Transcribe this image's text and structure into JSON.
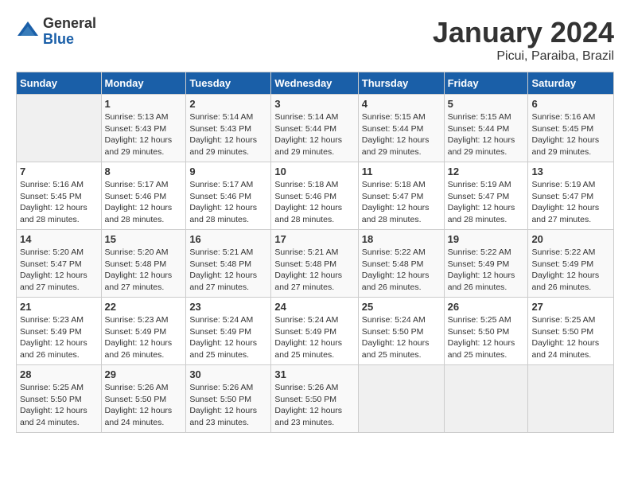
{
  "header": {
    "logo_general": "General",
    "logo_blue": "Blue",
    "title": "January 2024",
    "subtitle": "Picui, Paraiba, Brazil"
  },
  "calendar": {
    "days_of_week": [
      "Sunday",
      "Monday",
      "Tuesday",
      "Wednesday",
      "Thursday",
      "Friday",
      "Saturday"
    ],
    "weeks": [
      [
        {
          "day": "",
          "info": ""
        },
        {
          "day": "1",
          "info": "Sunrise: 5:13 AM\nSunset: 5:43 PM\nDaylight: 12 hours\nand 29 minutes."
        },
        {
          "day": "2",
          "info": "Sunrise: 5:14 AM\nSunset: 5:43 PM\nDaylight: 12 hours\nand 29 minutes."
        },
        {
          "day": "3",
          "info": "Sunrise: 5:14 AM\nSunset: 5:44 PM\nDaylight: 12 hours\nand 29 minutes."
        },
        {
          "day": "4",
          "info": "Sunrise: 5:15 AM\nSunset: 5:44 PM\nDaylight: 12 hours\nand 29 minutes."
        },
        {
          "day": "5",
          "info": "Sunrise: 5:15 AM\nSunset: 5:44 PM\nDaylight: 12 hours\nand 29 minutes."
        },
        {
          "day": "6",
          "info": "Sunrise: 5:16 AM\nSunset: 5:45 PM\nDaylight: 12 hours\nand 29 minutes."
        }
      ],
      [
        {
          "day": "7",
          "info": "Sunrise: 5:16 AM\nSunset: 5:45 PM\nDaylight: 12 hours\nand 28 minutes."
        },
        {
          "day": "8",
          "info": "Sunrise: 5:17 AM\nSunset: 5:46 PM\nDaylight: 12 hours\nand 28 minutes."
        },
        {
          "day": "9",
          "info": "Sunrise: 5:17 AM\nSunset: 5:46 PM\nDaylight: 12 hours\nand 28 minutes."
        },
        {
          "day": "10",
          "info": "Sunrise: 5:18 AM\nSunset: 5:46 PM\nDaylight: 12 hours\nand 28 minutes."
        },
        {
          "day": "11",
          "info": "Sunrise: 5:18 AM\nSunset: 5:47 PM\nDaylight: 12 hours\nand 28 minutes."
        },
        {
          "day": "12",
          "info": "Sunrise: 5:19 AM\nSunset: 5:47 PM\nDaylight: 12 hours\nand 28 minutes."
        },
        {
          "day": "13",
          "info": "Sunrise: 5:19 AM\nSunset: 5:47 PM\nDaylight: 12 hours\nand 27 minutes."
        }
      ],
      [
        {
          "day": "14",
          "info": "Sunrise: 5:20 AM\nSunset: 5:47 PM\nDaylight: 12 hours\nand 27 minutes."
        },
        {
          "day": "15",
          "info": "Sunrise: 5:20 AM\nSunset: 5:48 PM\nDaylight: 12 hours\nand 27 minutes."
        },
        {
          "day": "16",
          "info": "Sunrise: 5:21 AM\nSunset: 5:48 PM\nDaylight: 12 hours\nand 27 minutes."
        },
        {
          "day": "17",
          "info": "Sunrise: 5:21 AM\nSunset: 5:48 PM\nDaylight: 12 hours\nand 27 minutes."
        },
        {
          "day": "18",
          "info": "Sunrise: 5:22 AM\nSunset: 5:48 PM\nDaylight: 12 hours\nand 26 minutes."
        },
        {
          "day": "19",
          "info": "Sunrise: 5:22 AM\nSunset: 5:49 PM\nDaylight: 12 hours\nand 26 minutes."
        },
        {
          "day": "20",
          "info": "Sunrise: 5:22 AM\nSunset: 5:49 PM\nDaylight: 12 hours\nand 26 minutes."
        }
      ],
      [
        {
          "day": "21",
          "info": "Sunrise: 5:23 AM\nSunset: 5:49 PM\nDaylight: 12 hours\nand 26 minutes."
        },
        {
          "day": "22",
          "info": "Sunrise: 5:23 AM\nSunset: 5:49 PM\nDaylight: 12 hours\nand 26 minutes."
        },
        {
          "day": "23",
          "info": "Sunrise: 5:24 AM\nSunset: 5:49 PM\nDaylight: 12 hours\nand 25 minutes."
        },
        {
          "day": "24",
          "info": "Sunrise: 5:24 AM\nSunset: 5:49 PM\nDaylight: 12 hours\nand 25 minutes."
        },
        {
          "day": "25",
          "info": "Sunrise: 5:24 AM\nSunset: 5:50 PM\nDaylight: 12 hours\nand 25 minutes."
        },
        {
          "day": "26",
          "info": "Sunrise: 5:25 AM\nSunset: 5:50 PM\nDaylight: 12 hours\nand 25 minutes."
        },
        {
          "day": "27",
          "info": "Sunrise: 5:25 AM\nSunset: 5:50 PM\nDaylight: 12 hours\nand 24 minutes."
        }
      ],
      [
        {
          "day": "28",
          "info": "Sunrise: 5:25 AM\nSunset: 5:50 PM\nDaylight: 12 hours\nand 24 minutes."
        },
        {
          "day": "29",
          "info": "Sunrise: 5:26 AM\nSunset: 5:50 PM\nDaylight: 12 hours\nand 24 minutes."
        },
        {
          "day": "30",
          "info": "Sunrise: 5:26 AM\nSunset: 5:50 PM\nDaylight: 12 hours\nand 23 minutes."
        },
        {
          "day": "31",
          "info": "Sunrise: 5:26 AM\nSunset: 5:50 PM\nDaylight: 12 hours\nand 23 minutes."
        },
        {
          "day": "",
          "info": ""
        },
        {
          "day": "",
          "info": ""
        },
        {
          "day": "",
          "info": ""
        }
      ]
    ]
  }
}
